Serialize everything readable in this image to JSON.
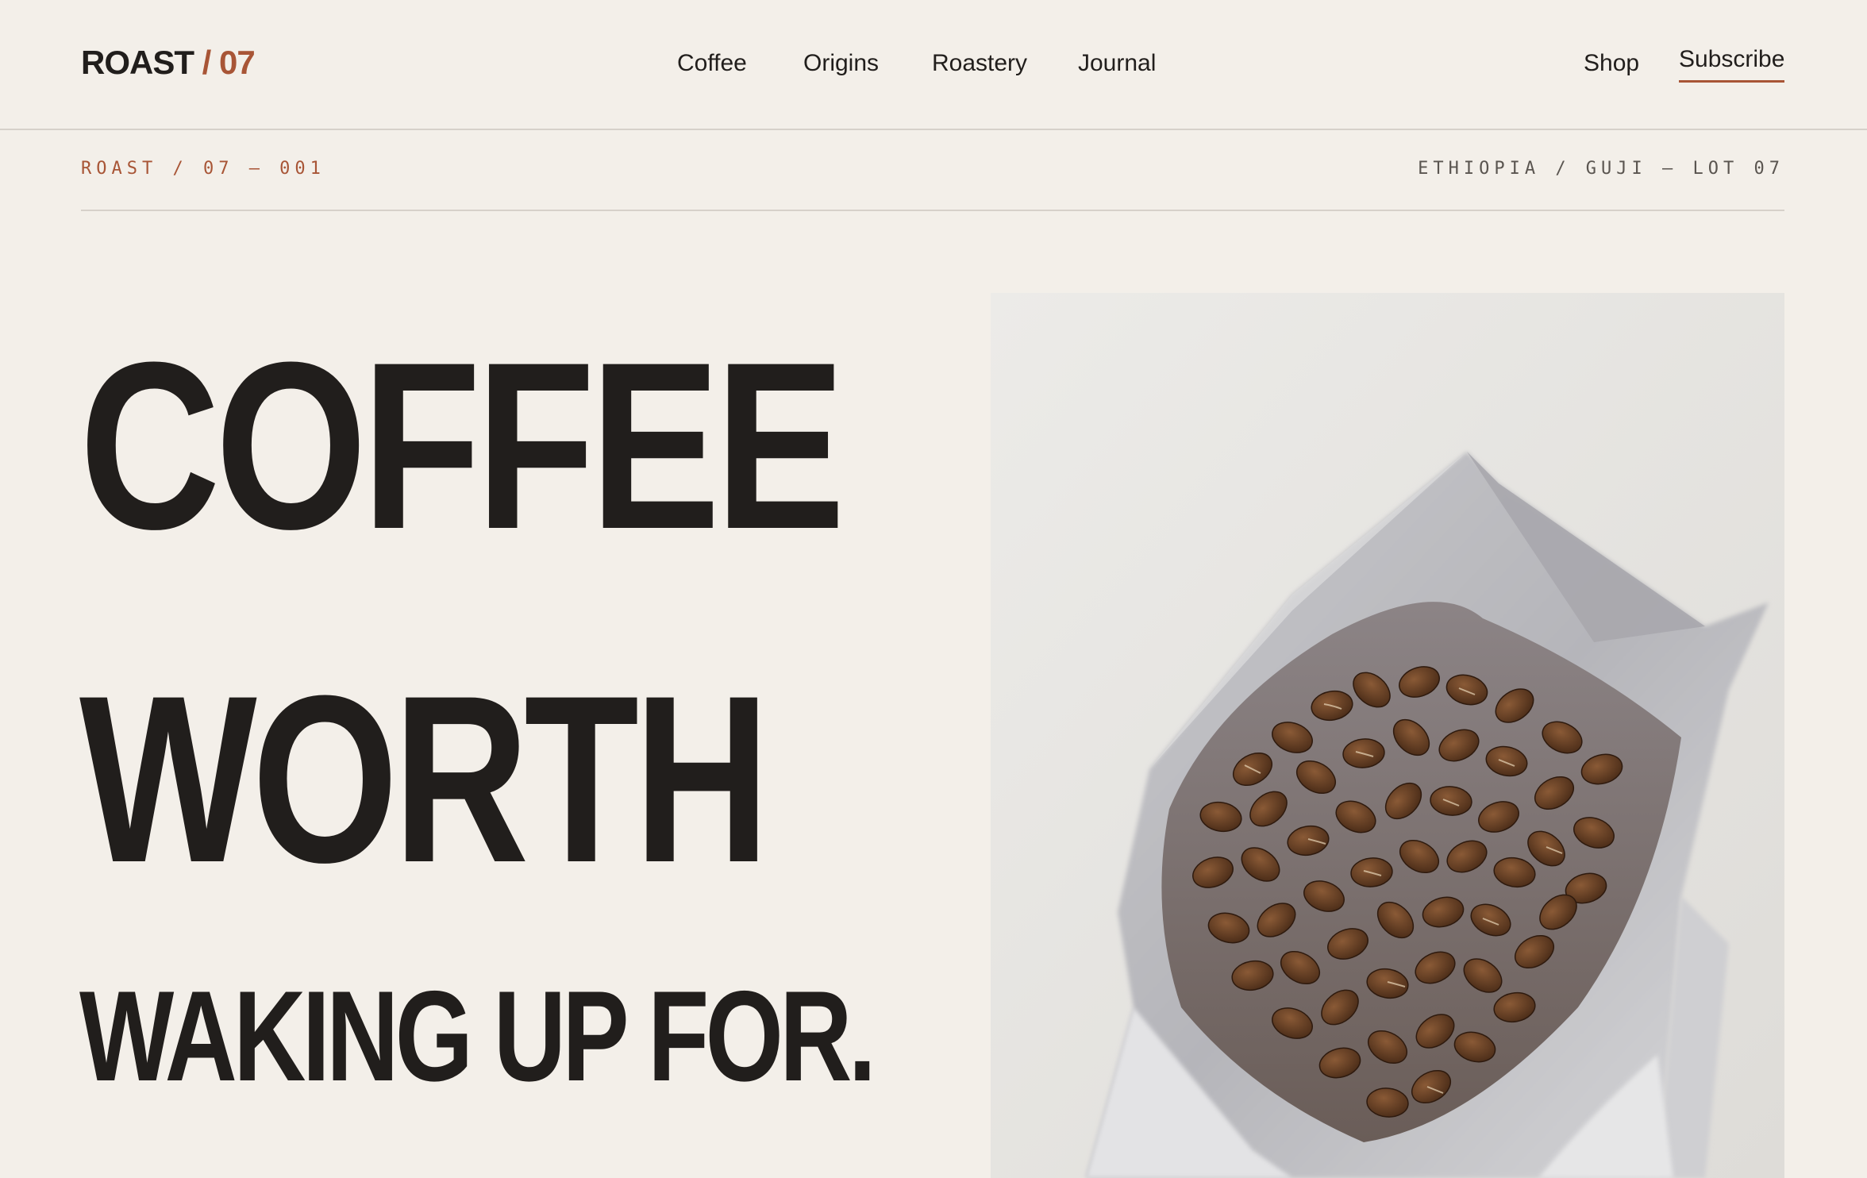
{
  "header": {
    "logo": {
      "brand": "ROAST",
      "separator": "/ 07"
    },
    "nav": {
      "primary": [
        "Coffee",
        "Origins",
        "Roastery",
        "Journal"
      ],
      "shop": "Shop",
      "subscribe": "Subscribe"
    }
  },
  "meta": {
    "left": "ROAST / 07 — 001",
    "right": "ETHIOPIA / GUJI — LOT 07"
  },
  "hero": {
    "headline": [
      "COFFEE",
      "WORTH",
      "WAKING UP FOR."
    ],
    "image": {
      "subject": "coffee-beans-in-open-bag"
    }
  },
  "colors": {
    "background": "#f3efe9",
    "text": "#211e1c",
    "accent": "#a85536",
    "muted": "#5a5550",
    "divider": "#d6d1ca"
  }
}
